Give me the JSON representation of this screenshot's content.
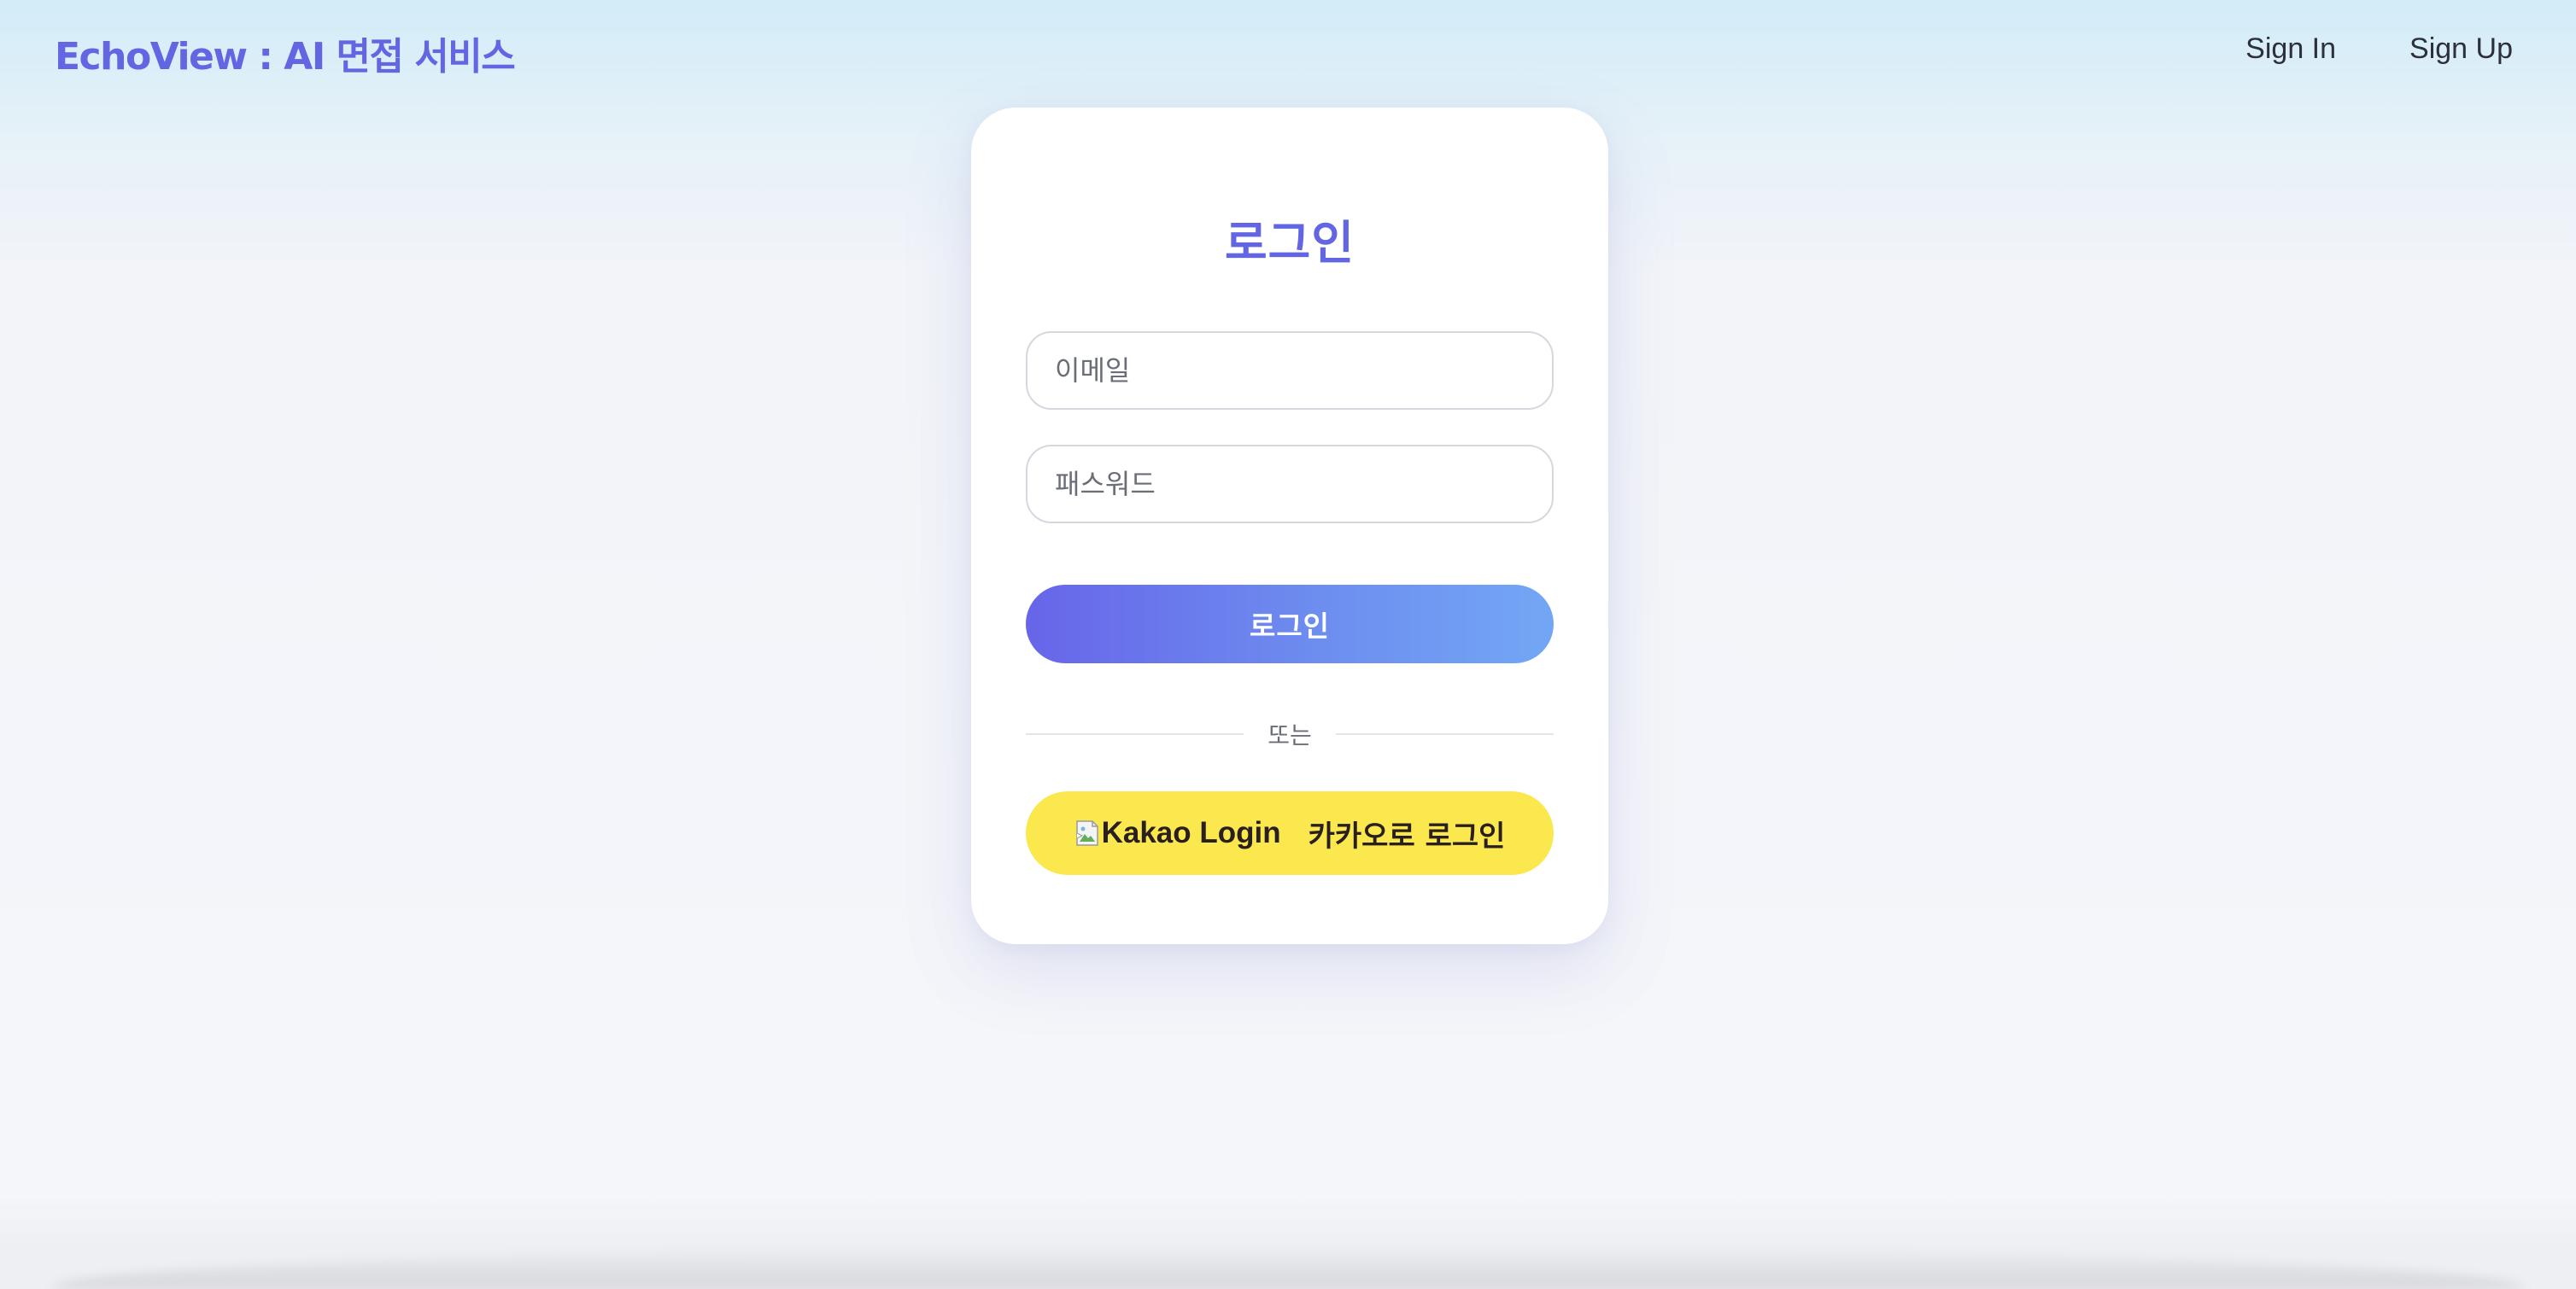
{
  "header": {
    "brand": "EchoView : AI 면접 서비스",
    "nav": {
      "sign_in": "Sign In",
      "sign_up": "Sign Up"
    }
  },
  "login_card": {
    "title": "로그인",
    "email_placeholder": "이메일",
    "password_placeholder": "패스워드",
    "login_button": "로그인",
    "divider_text": "또는",
    "kakao_image_alt": "Kakao Login",
    "kakao_button_text": "카카오로 로그인"
  },
  "colors": {
    "brand": "#6366e3",
    "kakao_yellow": "#fbe84e",
    "gradient_start": "#6765e9",
    "gradient_end": "#72a7f5"
  }
}
